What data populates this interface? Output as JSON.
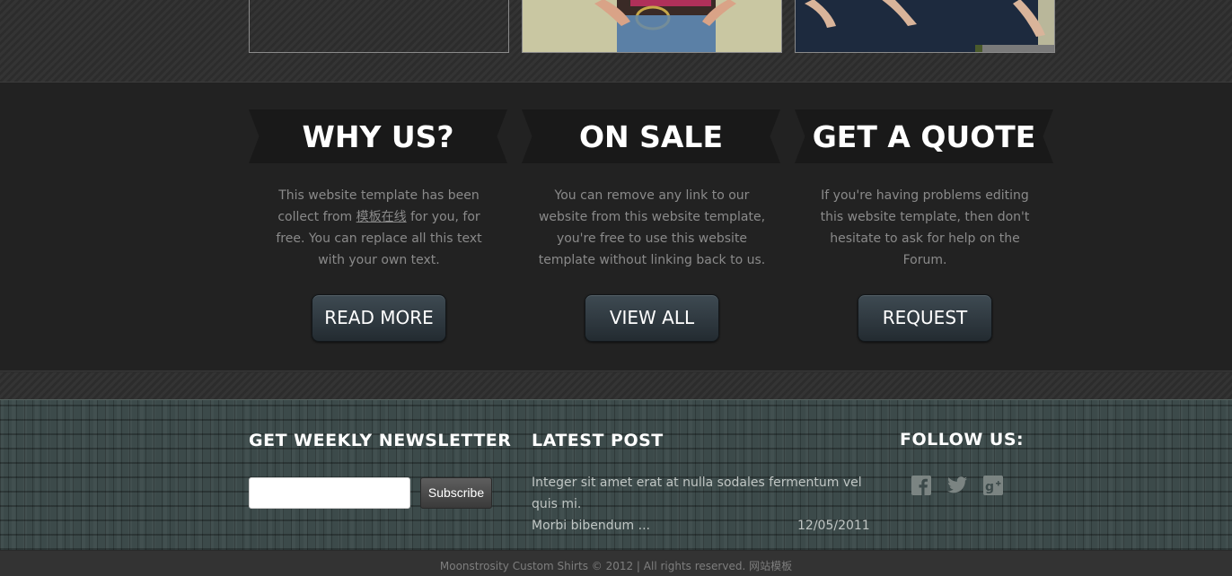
{
  "features": [
    {
      "title": "WHY US?",
      "text_before": "This website template has been collect from ",
      "link": "模板在线",
      "text_after": " for you, for free. You can replace all this text with your own text.",
      "button": "READ MORE"
    },
    {
      "title": "ON SALE",
      "text": "You can remove any link to our website from this website template, you're free to use this website template without linking back to us.",
      "button": "VIEW ALL"
    },
    {
      "title": "GET A QUOTE",
      "text": "If you're having problems editing this website template, then don't hesitate to ask for help on the Forum.",
      "button": "REQUEST"
    }
  ],
  "footer": {
    "newsletter": {
      "heading": "GET WEEKLY NEWSLETTER",
      "input_value": "",
      "button": "Subscribe"
    },
    "latest_post": {
      "heading": "LATEST POST",
      "text": "Integer sit amet erat at nulla sodales fermentum vel quis mi.",
      "more": "Morbi bibendum ...",
      "date": "12/05/2011"
    },
    "follow": {
      "heading": "FOLLOW US:",
      "icons": [
        "facebook-icon",
        "twitter-icon",
        "google-plus-icon"
      ]
    }
  },
  "copyright": {
    "text": "Moonstrosity Custom Shirts © 2012 | All rights reserved. ",
    "link": "网站模板"
  },
  "colors": {
    "feature_bg": "#222222",
    "ribbon_bg": "#191919",
    "button_top": "#3e4a52",
    "footer_bg": "#3c4a4a"
  }
}
